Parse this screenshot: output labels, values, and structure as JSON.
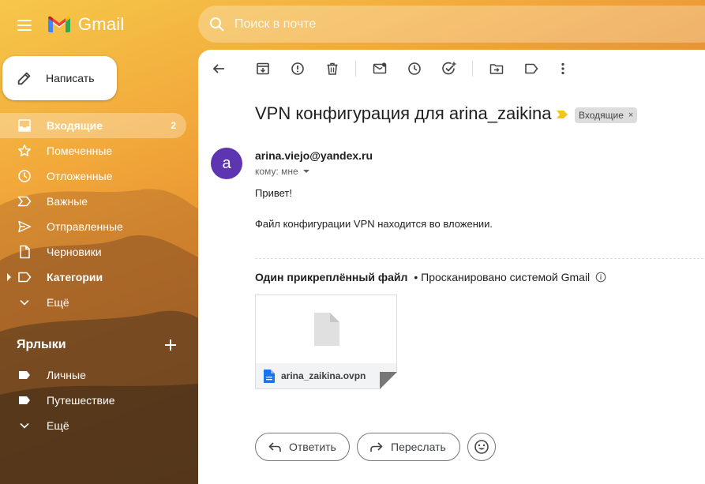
{
  "app": {
    "name": "Gmail",
    "logo_icon": "gmail-m-icon"
  },
  "search": {
    "placeholder": "Поиск в почте",
    "icon": "search-icon"
  },
  "compose": {
    "label": "Написать",
    "icon": "pencil-icon"
  },
  "sidebar": {
    "items": [
      {
        "label": "Входящие",
        "count": "2",
        "icon": "inbox-icon",
        "active": true
      },
      {
        "label": "Помеченные",
        "icon": "star-icon"
      },
      {
        "label": "Отложенные",
        "icon": "clock-icon"
      },
      {
        "label": "Важные",
        "icon": "important-icon"
      },
      {
        "label": "Отправленные",
        "icon": "send-icon"
      },
      {
        "label": "Черновики",
        "icon": "draft-icon"
      },
      {
        "label": "Категории",
        "icon": "label-icon",
        "bold": true
      },
      {
        "label": "Ещё",
        "icon": "chevron-down-icon"
      }
    ],
    "labels_title": "Ярлыки",
    "labels": [
      {
        "label": "Личные",
        "icon": "label-icon"
      },
      {
        "label": "Путешествие",
        "icon": "label-icon"
      },
      {
        "label": "Ещё",
        "icon": "chevron-down-icon"
      }
    ]
  },
  "toolbar": {
    "icons": [
      "back-arrow-icon",
      "archive-icon",
      "report-spam-icon",
      "delete-icon",
      "mark-unread-icon",
      "snooze-icon",
      "add-task-icon",
      "move-to-icon",
      "labels-icon",
      "more-vert-icon"
    ]
  },
  "message": {
    "subject": "VPN конфигурация для arina_zaikina",
    "chip_label": "Входящие",
    "chip_close": "×",
    "avatar_letter": "a",
    "avatar_color": "#5e35b1",
    "sender": "arina.viejo@yandex.ru",
    "to": "кому: мне",
    "body_lines": [
      "Привет!",
      "Файл конфигурации VPN находится во вложении."
    ],
    "attachments_title": "Один прикреплённый файл",
    "attachments_scan": "• Просканировано системой Gmail",
    "attachment": {
      "filename": "arina_zaikina.ovpn",
      "icon": "file-icon"
    }
  },
  "actions": {
    "reply": "Ответить",
    "forward": "Переслать",
    "emoji_icon": "emoji-icon"
  },
  "colors": {
    "accent_blue": "#1a73e8",
    "important_yellow": "#f5c518",
    "chip_bg": "#dddddd"
  }
}
